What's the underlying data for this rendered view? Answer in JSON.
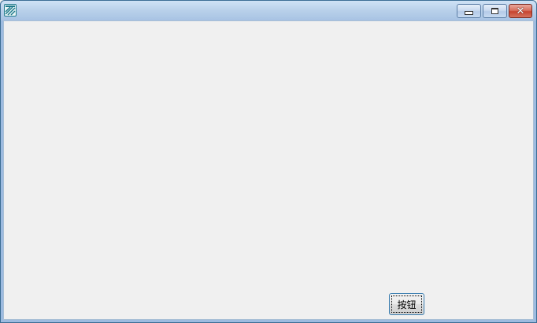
{
  "window": {
    "title": "",
    "icon": "app-logo-icon"
  },
  "caption_buttons": {
    "minimize_icon": "minimize-icon",
    "maximize_icon": "maximize-icon",
    "close_icon": "close-icon",
    "close_glyph": "✕"
  },
  "main": {
    "button_label": "按钮"
  },
  "colors": {
    "title_bar": "#b9d1ea",
    "client_bg": "#f0f0f0",
    "close_button": "#c7432f"
  }
}
